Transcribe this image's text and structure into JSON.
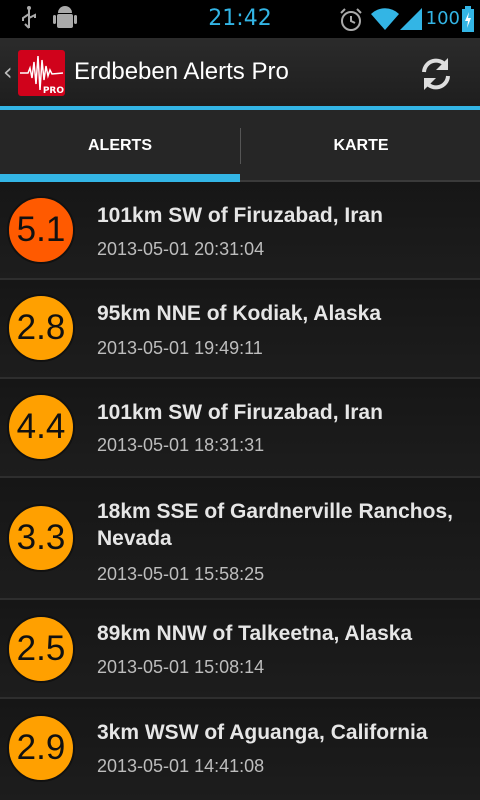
{
  "status_bar": {
    "time": "21:42",
    "battery_level": "100",
    "icons": [
      "usb-icon",
      "android-debug-icon",
      "alarm-icon",
      "wifi-icon",
      "signal-icon",
      "battery-charging-icon"
    ]
  },
  "action_bar": {
    "title": "Erdbeben Alerts Pro",
    "logo_badge": "PRO",
    "up_icon": "up-caret-icon",
    "refresh_icon": "refresh-icon"
  },
  "tabs": [
    {
      "label": "ALERTS",
      "selected": true
    },
    {
      "label": "KARTE",
      "selected": false
    }
  ],
  "colors": {
    "accent": "#33b5e5",
    "magnitude_strong": "#ff5a00",
    "magnitude_light": "#ffa000"
  },
  "alerts": [
    {
      "magnitude": "5.1",
      "place": "101km SW of Firuzabad, Iran",
      "time": "2013-05-01 20:31:04"
    },
    {
      "magnitude": "2.8",
      "place": "95km NNE of Kodiak, Alaska",
      "time": "2013-05-01 19:49:11"
    },
    {
      "magnitude": "4.4",
      "place": "101km SW of Firuzabad, Iran",
      "time": "2013-05-01 18:31:31"
    },
    {
      "magnitude": "3.3",
      "place": "18km SSE of Gardnerville Ranchos, Nevada",
      "time": "2013-05-01 15:58:25"
    },
    {
      "magnitude": "2.5",
      "place": "89km NNW of Talkeetna, Alaska",
      "time": "2013-05-01 15:08:14"
    },
    {
      "magnitude": "2.9",
      "place": "3km WSW of Aguanga, California",
      "time": "2013-05-01 14:41:08"
    }
  ]
}
